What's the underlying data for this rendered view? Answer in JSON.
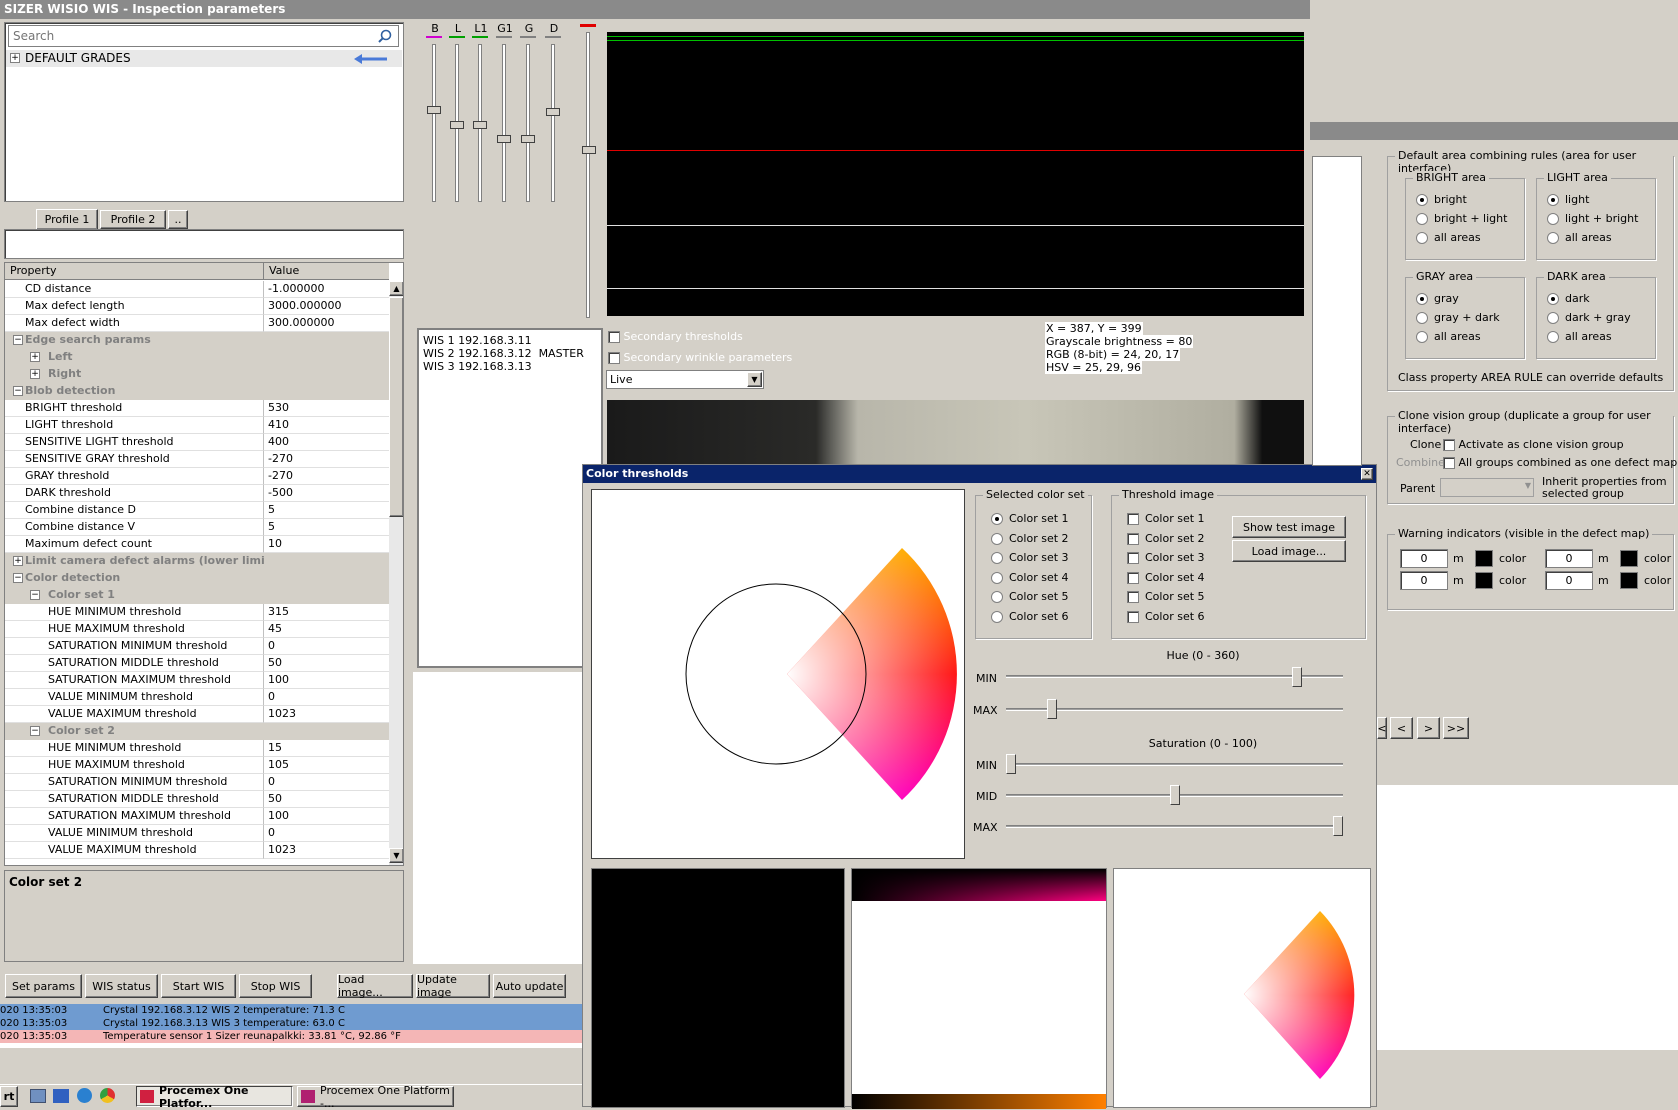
{
  "window_title": "SIZER WISIO WIS - Inspection parameters",
  "search": {
    "placeholder": "Search"
  },
  "tree": {
    "root_label": "DEFAULT GRADES"
  },
  "tabs": [
    "Profile 1",
    "Profile 2",
    ".."
  ],
  "property_grid": {
    "header_property": "Property",
    "header_value": "Value",
    "rows": [
      {
        "name": "CD distance",
        "value": "-1.000000"
      },
      {
        "name": "Max defect length",
        "value": "3000.000000"
      },
      {
        "name": "Max defect width",
        "value": "300.000000"
      },
      {
        "name": "Edge search params",
        "value": ""
      },
      {
        "name": "Left",
        "value": ""
      },
      {
        "name": "Right",
        "value": ""
      },
      {
        "name": "Blob detection",
        "value": ""
      },
      {
        "name": "BRIGHT threshold",
        "value": "530"
      },
      {
        "name": "LIGHT threshold",
        "value": "410"
      },
      {
        "name": "SENSITIVE LIGHT threshold",
        "value": "400"
      },
      {
        "name": "SENSITIVE GRAY threshold",
        "value": "-270"
      },
      {
        "name": "GRAY threshold",
        "value": "-270"
      },
      {
        "name": "DARK threshold",
        "value": "-500"
      },
      {
        "name": "Combine distance D",
        "value": "5"
      },
      {
        "name": "Combine distance V",
        "value": "5"
      },
      {
        "name": "Maximum defect count",
        "value": "10"
      },
      {
        "name": "Limit camera defect alarms (lower limit)",
        "value": ""
      },
      {
        "name": "Color detection",
        "value": ""
      },
      {
        "name": "Color set 1",
        "value": ""
      },
      {
        "name": "HUE MINIMUM threshold",
        "value": "315"
      },
      {
        "name": "HUE MAXIMUM threshold",
        "value": "45"
      },
      {
        "name": "SATURATION MINIMUM threshold",
        "value": "0"
      },
      {
        "name": "SATURATION MIDDLE threshold",
        "value": "50"
      },
      {
        "name": "SATURATION MAXIMUM threshold",
        "value": "100"
      },
      {
        "name": "VALUE MINIMUM threshold",
        "value": "0"
      },
      {
        "name": "VALUE MAXIMUM threshold",
        "value": "1023"
      },
      {
        "name": "Color set 2",
        "value": ""
      },
      {
        "name": "HUE MINIMUM threshold",
        "value": "15"
      },
      {
        "name": "HUE MAXIMUM threshold",
        "value": "105"
      },
      {
        "name": "SATURATION MINIMUM threshold",
        "value": "0"
      },
      {
        "name": "SATURATION MIDDLE threshold",
        "value": "50"
      },
      {
        "name": "SATURATION MAXIMUM threshold",
        "value": "100"
      },
      {
        "name": "VALUE MINIMUM threshold",
        "value": "0"
      },
      {
        "name": "VALUE MAXIMUM threshold",
        "value": "1023"
      }
    ]
  },
  "description": {
    "title": "Color set 2"
  },
  "bottom_buttons": [
    "Set params",
    "WIS status",
    "Start WIS",
    "Stop WIS",
    "Load image...",
    "Update image",
    "Auto update"
  ],
  "log": [
    {
      "time": "020 13:35:03",
      "text": "Crystal 192.168.3.12 WIS 2 temperature: 71.3 C",
      "color": "#6f9bd0"
    },
    {
      "time": "020 13:35:03",
      "text": "Crystal 192.168.3.13 WIS 3 temperature: 63.0 C",
      "color": "#6f9bd0"
    },
    {
      "time": "020 13:35:03",
      "text": "Temperature sensor 1 Sizer reunapalkki: 33.81 °C, 92.86 °F",
      "color": "#f4b6b6"
    }
  ],
  "sliders": {
    "labels": [
      "B",
      "L",
      "L1",
      "G1",
      "G",
      "D"
    ],
    "colors": [
      "#d000d0",
      "#00a000",
      "#00a000",
      "#808080",
      "#808080",
      "#808080"
    ]
  },
  "wis_list": [
    "WIS 1 192.168.3.11",
    "WIS 2 192.168.3.12  MASTER",
    "WIS 3 192.168.3.13"
  ],
  "checks": {
    "secondary_thresholds": "Secondary thresholds",
    "secondary_wrinkle": "Secondary wrinkle parameters"
  },
  "live_select": "Live",
  "pixel_info": [
    "X = 387, Y = 399",
    "Grayscale brightness = 80",
    "RGB (8-bit) = 24, 20, 17",
    "HSV = 25, 29, 96"
  ],
  "color_dialog": {
    "title": "Color thresholds",
    "selected_color_set_label": "Selected color set",
    "color_sets": [
      "Color set 1",
      "Color set 2",
      "Color set 3",
      "Color set 4",
      "Color set 5",
      "Color set 6"
    ],
    "threshold_image_label": "Threshold image",
    "show_test_image": "Show test image",
    "load_image": "Load image...",
    "hue_label": "Hue (0 - 360)",
    "saturation_label": "Saturation (0 - 100)",
    "min": "MIN",
    "max": "MAX",
    "mid": "MID",
    "hue_min": 315,
    "hue_max": 45,
    "sat_min": 0,
    "sat_mid": 50,
    "sat_max": 100
  },
  "area_rules": {
    "title": "Default area combining rules (area for user interface)",
    "bright": {
      "label": "BRIGHT area",
      "options": [
        "bright",
        "bright + light",
        "all areas"
      ]
    },
    "light": {
      "label": "LIGHT area",
      "options": [
        "light",
        "light + bright",
        "all areas"
      ]
    },
    "gray": {
      "label": "GRAY area",
      "options": [
        "gray",
        "gray + dark",
        "all areas"
      ]
    },
    "dark": {
      "label": "DARK area",
      "options": [
        "dark",
        "dark + gray",
        "all areas"
      ]
    },
    "note": "Class property AREA RULE can override defaults"
  },
  "clone": {
    "title": "Clone vision group (duplicate a group for user interface)",
    "clone_label": "Clone",
    "clone_check": "Activate as clone vision group",
    "combine_label": "Combine",
    "combine_check": "All groups combined as one defect map",
    "parent_label": "Parent",
    "inherit": "Inherit properties from selected group"
  },
  "warning": {
    "title": "Warning indicators (visible in the defect map)",
    "fields": [
      {
        "value": "0",
        "unit": "m",
        "color": "color"
      },
      {
        "value": "0",
        "unit": "m",
        "color": "color"
      },
      {
        "value": "0",
        "unit": "m",
        "color": "color"
      },
      {
        "value": "0",
        "unit": "m",
        "color": "color"
      }
    ]
  },
  "nav": [
    "<",
    "<",
    ">",
    ">>"
  ],
  "taskbar": {
    "start": "rt",
    "items": [
      "Procemex One Platfor...",
      "Procemex One Platform -..."
    ]
  }
}
